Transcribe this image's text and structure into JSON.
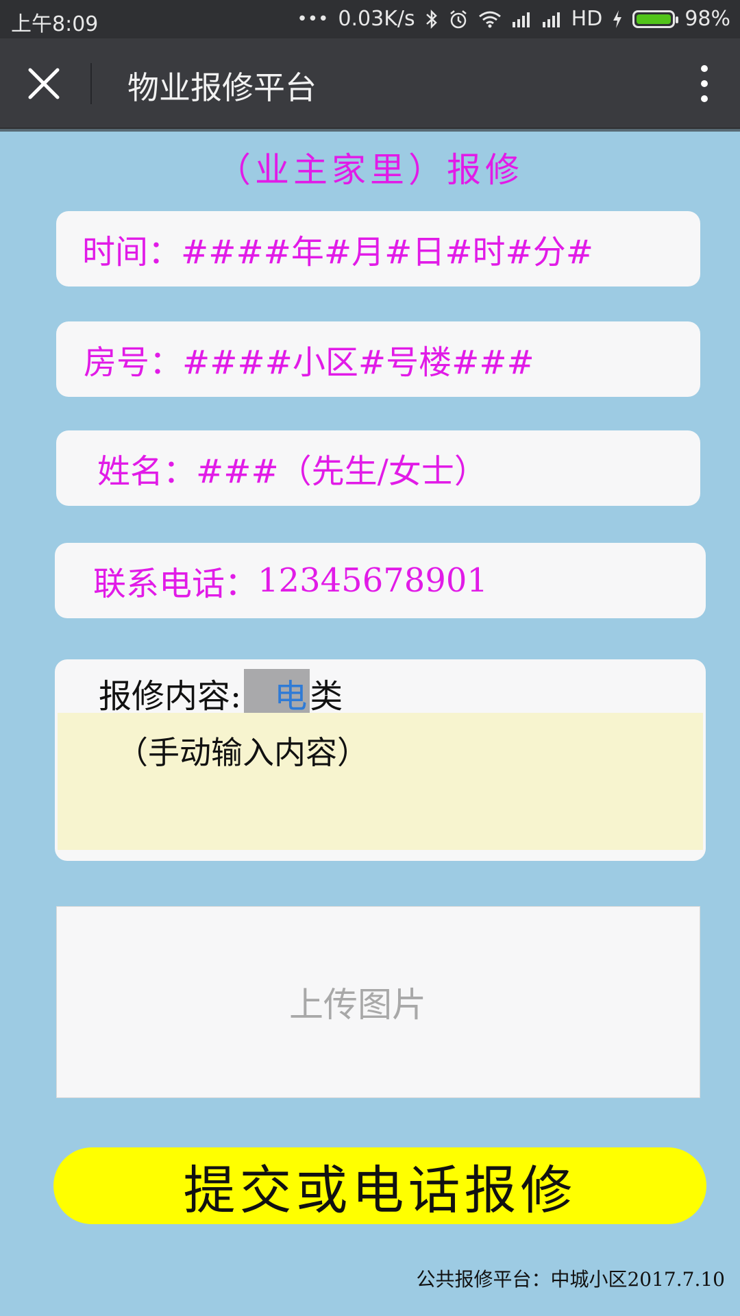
{
  "status_bar": {
    "time": "上午8:09",
    "dots": "•••",
    "net_speed": "0.03K/s",
    "hd": "HD",
    "battery": "98%"
  },
  "nav": {
    "title": "物业报修平台"
  },
  "heading": "（业主家里）报修",
  "form": {
    "time": {
      "label": "时间：",
      "value": "####年#月#日#时#分#"
    },
    "room": {
      "label": "房号：",
      "value": "####小区#号楼###"
    },
    "name": {
      "label": "姓名：",
      "value": "###（先生/女士）"
    },
    "phone": {
      "label": "联系电话：",
      "value": "12345678901"
    },
    "content": {
      "label": "报修内容:",
      "category_selected": "电",
      "category_suffix": "类",
      "placeholder": "（手动输入内容）"
    },
    "upload_label": "上传图片",
    "submit_label": "提交或电话报修"
  },
  "footer": "公共报修平台：中城小区2017.7.10",
  "colors": {
    "background": "#9dcbe3",
    "accent_text": "#e11be7",
    "submit_bg": "#ffff00",
    "battery_fill": "#52c41a"
  }
}
